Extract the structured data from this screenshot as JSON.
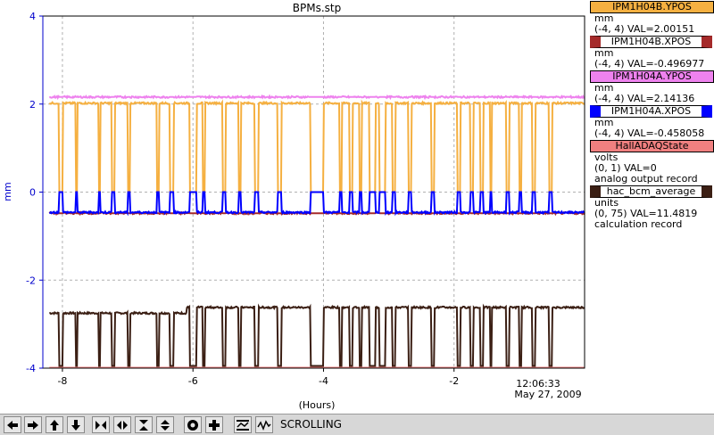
{
  "window": {
    "title": "BPMs.stp"
  },
  "chart_data": {
    "type": "line",
    "title": "BPMs.stp",
    "ylabel": "mm",
    "xlabel": "(Hours)",
    "ylim": [
      -4,
      4
    ],
    "xlim": [
      -8.3,
      0
    ],
    "yticks": [
      "4",
      "2",
      "0",
      "-2",
      "-4"
    ],
    "xticks": [
      "-8",
      "-6",
      "-4",
      "-2"
    ],
    "grid": true,
    "end_time": "12:06:33",
    "end_date": "May 27, 2009",
    "series": [
      {
        "name": "IPM1H04B.YPOS",
        "color": "#f5b041",
        "units": "mm",
        "range": "(-4, 4)",
        "value": 2.00151,
        "base": 2.02,
        "low": 0.0
      },
      {
        "name": "IPM1H04B.XPOS",
        "color": "#a52a2a",
        "units": "mm",
        "range": "(-4, 4)",
        "value": -0.496977,
        "base": -0.48,
        "low": -0.48
      },
      {
        "name": "IPM1H04A.YPOS",
        "color": "#ee82ee",
        "units": "mm",
        "range": "(-4, 4)",
        "value": 2.14136,
        "base": 2.16,
        "low": 2.16
      },
      {
        "name": "IPM1H04A.XPOS",
        "color": "#0000ff",
        "units": "mm",
        "range": "(-4, 4)",
        "value": -0.458058,
        "base": -0.46,
        "low": 0.0
      },
      {
        "name": "HallADAQState",
        "color": "#f08080",
        "units": "volts",
        "range": "(0, 1)",
        "value": 0,
        "base": -3.99,
        "low": -3.99
      },
      {
        "name": "hac_bcm_average",
        "color": "#3b1f14",
        "units": "units",
        "range": "(0, 75)",
        "value": 11.4819,
        "base": -2.75,
        "low": -3.95
      }
    ],
    "gaps": [
      [
        -8.05,
        -8.0
      ],
      [
        -7.8,
        -7.77
      ],
      [
        -7.45,
        -7.42
      ],
      [
        -7.25,
        -7.2
      ],
      [
        -7.0,
        -6.97
      ],
      [
        -6.55,
        -6.52
      ],
      [
        -6.35,
        -6.3
      ],
      [
        -6.05,
        -5.95
      ],
      [
        -5.85,
        -5.82
      ],
      [
        -5.55,
        -5.5
      ],
      [
        -5.3,
        -5.27
      ],
      [
        -5.05,
        -5.0
      ],
      [
        -4.7,
        -4.65
      ],
      [
        -4.2,
        -4.0
      ],
      [
        -3.75,
        -3.72
      ],
      [
        -3.6,
        -3.55
      ],
      [
        -3.45,
        -3.42
      ],
      [
        -3.3,
        -3.2
      ],
      [
        -3.15,
        -3.05
      ],
      [
        -2.95,
        -2.9
      ],
      [
        -2.7,
        -2.65
      ],
      [
        -2.35,
        -2.3
      ],
      [
        -1.95,
        -1.9
      ],
      [
        -1.75,
        -1.7
      ],
      [
        -1.6,
        -1.55
      ],
      [
        -1.45,
        -1.42
      ],
      [
        -1.2,
        -1.15
      ],
      [
        -1.0,
        -0.97
      ],
      [
        -0.8,
        -0.75
      ],
      [
        -0.55,
        -0.5
      ]
    ]
  },
  "legend": [
    {
      "name": "IPM1H04B.YPOS",
      "color": "#f5b041",
      "lines": [
        "mm",
        "(-4, 4) VAL=2.00151"
      ]
    },
    {
      "name": "IPM1H04B.XPOS",
      "color": "#a52a2a",
      "lines": [
        "mm",
        "(-4, 4) VAL=-0.496977"
      ]
    },
    {
      "name": "IPM1H04A.YPOS",
      "color": "#ee82ee",
      "lines": [
        "mm",
        "(-4, 4) VAL=2.14136"
      ]
    },
    {
      "name": "IPM1H04A.XPOS",
      "color": "#0000ff",
      "lines": [
        "mm",
        "(-4, 4) VAL=-0.458058"
      ]
    },
    {
      "name": "HallADAQState",
      "color": "#f08080",
      "lines": [
        "volts",
        "(0, 1) VAL=0",
        "analog output record"
      ]
    },
    {
      "name": "hac_bcm_average",
      "color": "#3b1f14",
      "lines": [
        "units",
        "(0, 75) VAL=11.4819",
        "calculation record"
      ]
    }
  ],
  "toolbar": {
    "status_label": "SCROLLING",
    "buttons": [
      {
        "name": "scroll-left-icon"
      },
      {
        "name": "scroll-right-icon"
      },
      {
        "name": "scroll-up-icon"
      },
      {
        "name": "scroll-down-icon"
      },
      {
        "name": "zoom-x-in-icon"
      },
      {
        "name": "zoom-x-out-icon"
      },
      {
        "name": "zoom-y-in-icon"
      },
      {
        "name": "zoom-y-out-icon"
      },
      {
        "name": "record-icon"
      },
      {
        "name": "crosshair-icon"
      },
      {
        "name": "auto-scale-icon"
      },
      {
        "name": "scroll-mode-icon"
      }
    ]
  }
}
